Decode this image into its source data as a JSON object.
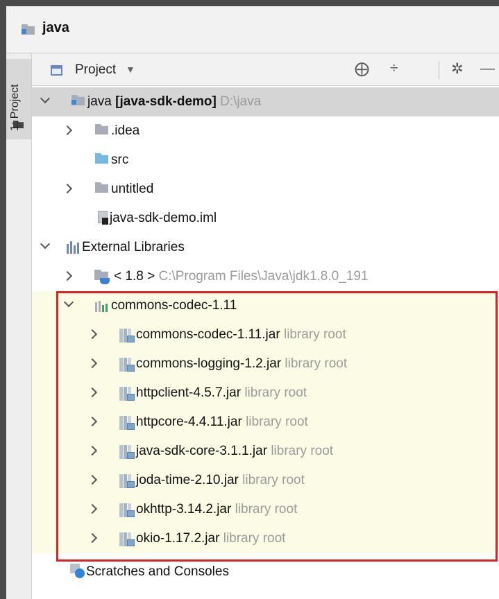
{
  "window": {
    "title": "java"
  },
  "side_tab": {
    "label": "1: Project"
  },
  "toolbar": {
    "view_label": "Project",
    "dropdown_caret": "▼",
    "icons": [
      "locate-icon",
      "collapse-all-icon",
      "gear-icon",
      "minimize-icon"
    ],
    "locate_glyph": "⨁",
    "collapse_glyph": "÷",
    "gear_glyph": "✲",
    "hide_glyph": "—"
  },
  "tree": {
    "root": {
      "name": "java",
      "module": "[java-sdk-demo]",
      "path": "D:\\java"
    },
    "children": [
      {
        "name": ".idea"
      },
      {
        "name": "src"
      },
      {
        "name": "untitled"
      },
      {
        "name": "java-sdk-demo.iml"
      }
    ],
    "external_libraries": {
      "name": "External Libraries"
    },
    "jdk": {
      "name": "< 1.8 >",
      "path": "C:\\Program Files\\Java\\jdk1.8.0_191"
    },
    "library": {
      "name": "commons-codec-1.11"
    },
    "jars": [
      {
        "name": "commons-codec-1.11.jar",
        "hint": "library root"
      },
      {
        "name": "commons-logging-1.2.jar",
        "hint": "library root"
      },
      {
        "name": "httpclient-4.5.7.jar",
        "hint": "library root"
      },
      {
        "name": "httpcore-4.4.11.jar",
        "hint": "library root"
      },
      {
        "name": "java-sdk-core-3.1.1.jar",
        "hint": "library root"
      },
      {
        "name": "joda-time-2.10.jar",
        "hint": "library root"
      },
      {
        "name": "okhttp-3.14.2.jar",
        "hint": "library root"
      },
      {
        "name": "okio-1.17.2.jar",
        "hint": "library root"
      }
    ],
    "scratches": {
      "name": "Scratches and Consoles"
    }
  },
  "colors": {
    "highlight_border": "#e02020",
    "highlight_bg": "#fbfbe6",
    "selected_bg": "#d5d5d5",
    "hint_text": "#9b9b9b"
  }
}
